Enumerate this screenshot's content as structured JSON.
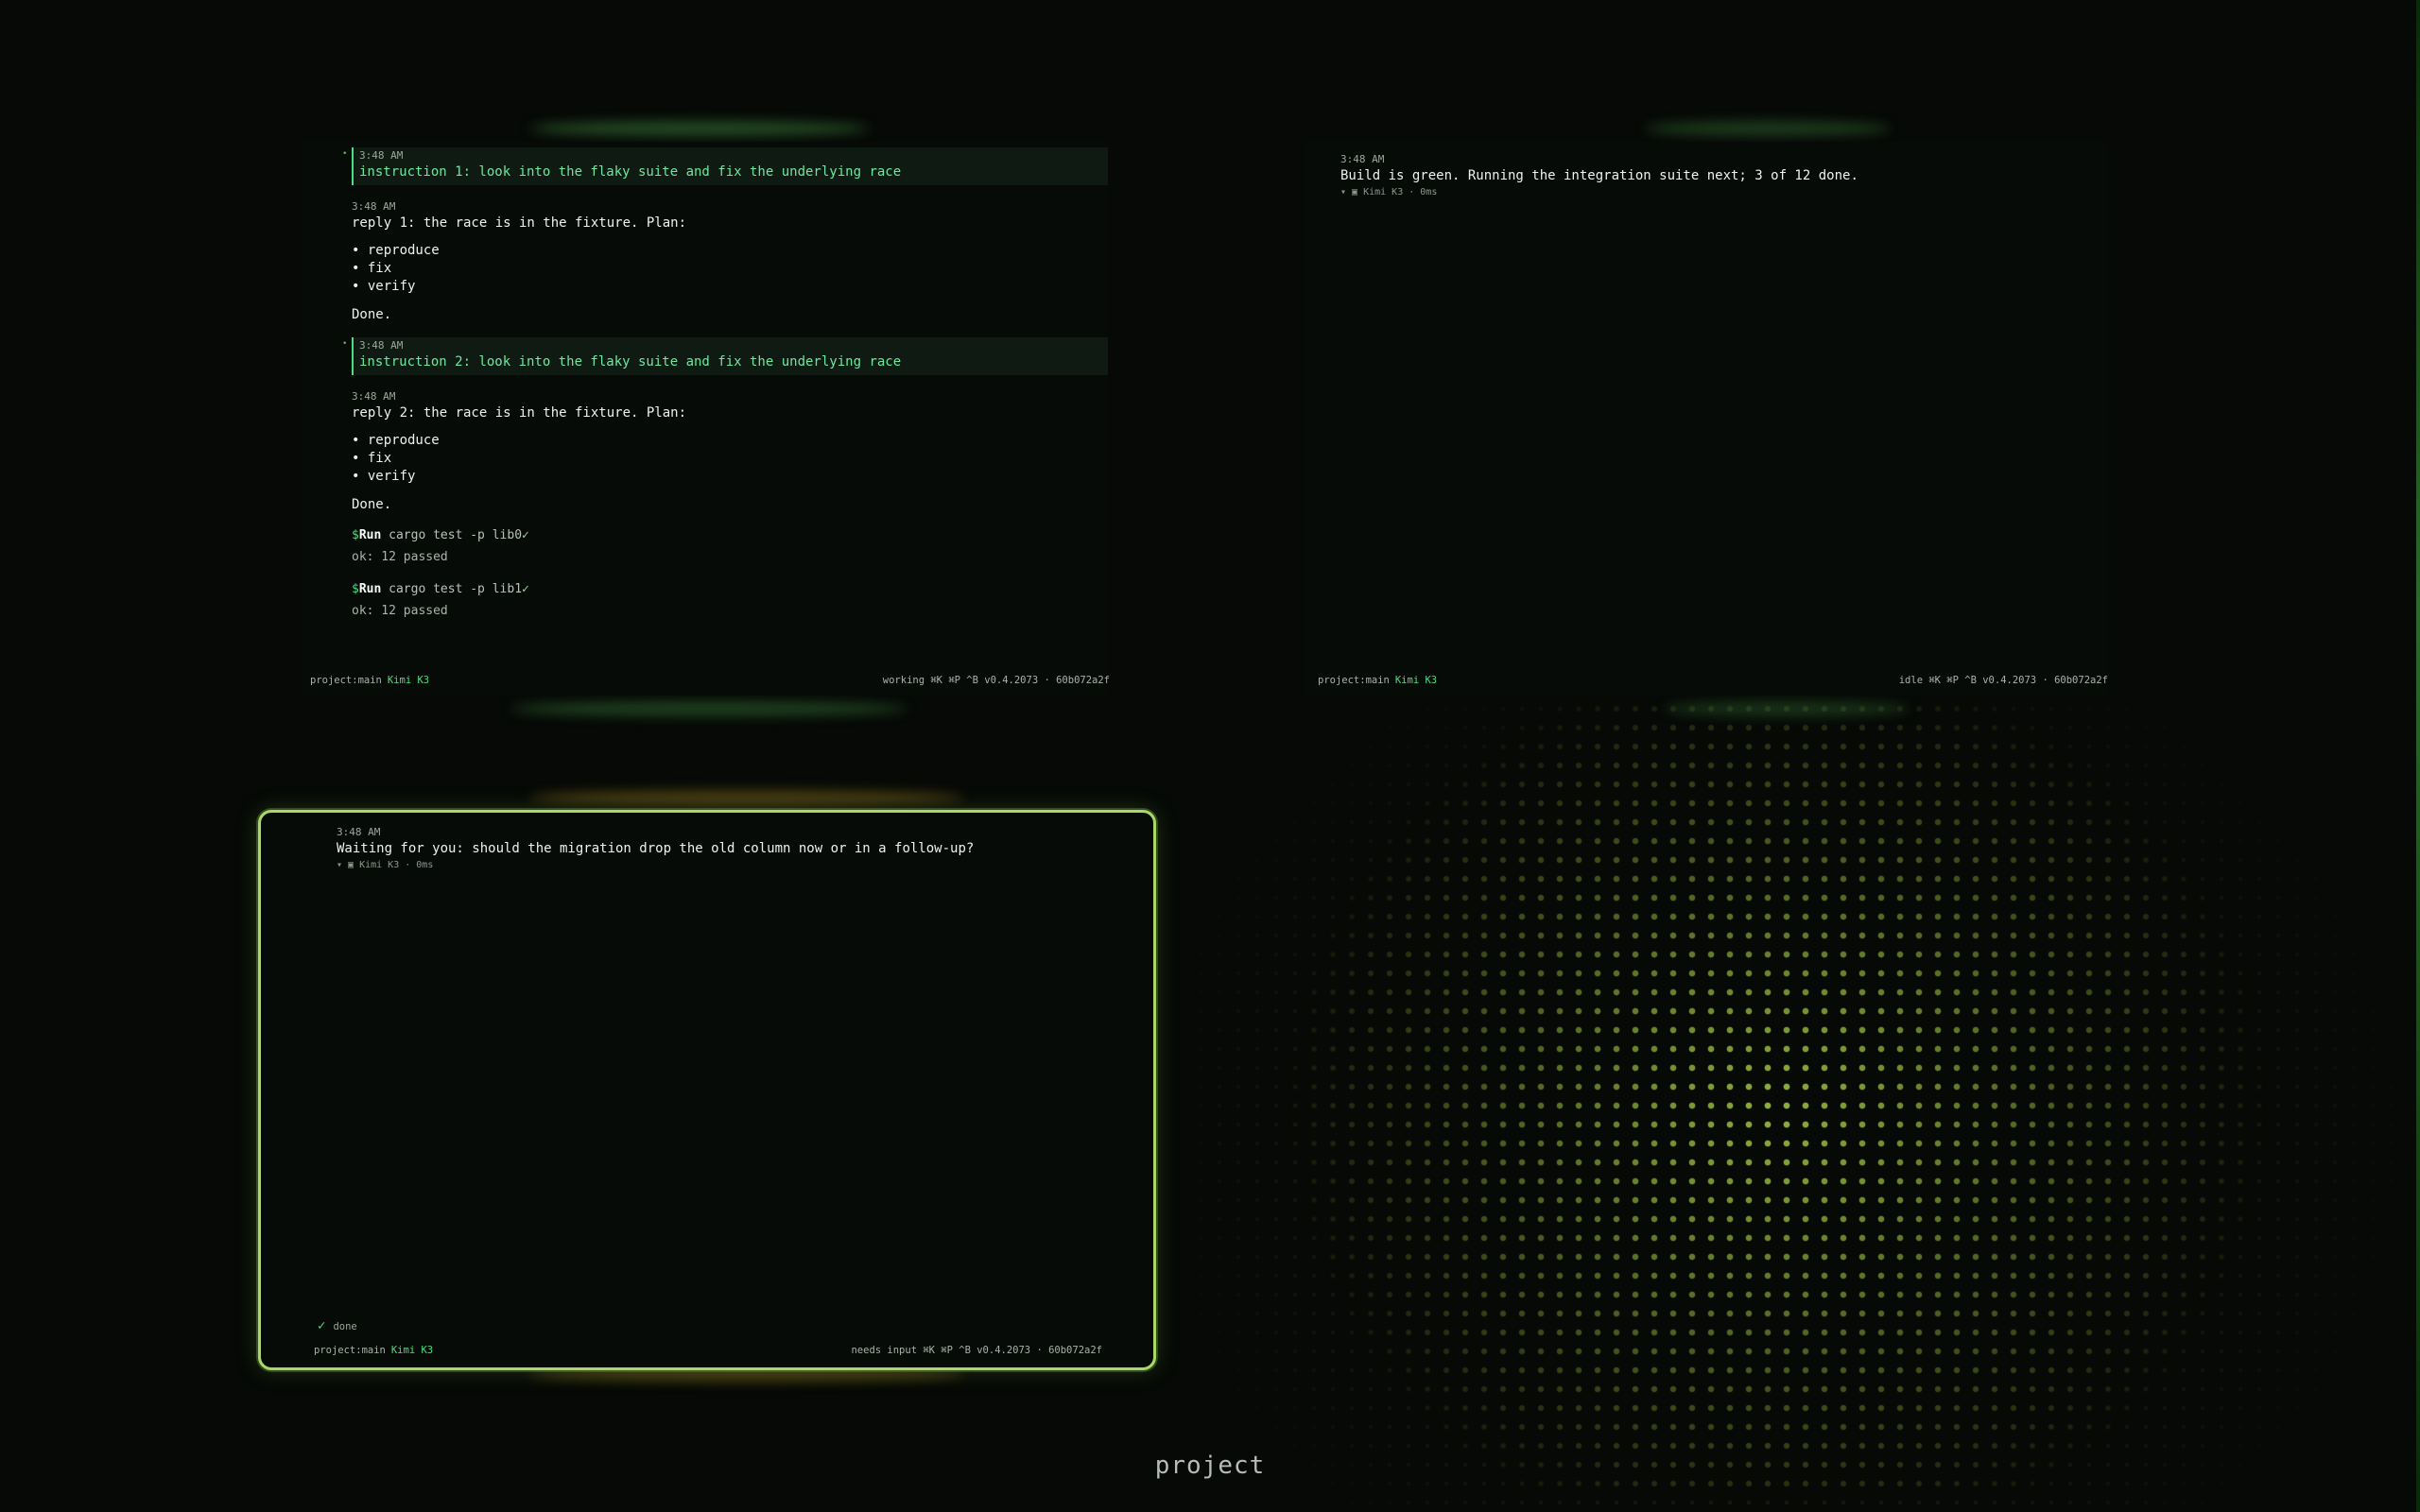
{
  "workspace_title": "project",
  "panes": [
    {
      "id": "pane-top-left",
      "status_left": "project:main",
      "model": "Kimi K3",
      "status_right": "working ⌘K ⌘P ^B v0.4.2073 · 60b072a2f",
      "entries": [
        {
          "kind": "instruction",
          "time": "3:48 AM",
          "text": "instruction 1: look into the flaky suite and fix the underlying race"
        },
        {
          "kind": "reply",
          "time": "3:48 AM",
          "text": "reply 1: the race is in the fixture. Plan:",
          "bullets": [
            "• reproduce",
            "• fix",
            "• verify"
          ],
          "done": "Done."
        },
        {
          "kind": "instruction",
          "time": "3:48 AM",
          "text": "instruction 2: look into the flaky suite and fix the underlying race"
        },
        {
          "kind": "reply",
          "time": "3:48 AM",
          "text": "reply 2: the race is in the fixture. Plan:",
          "bullets": [
            "• reproduce",
            "• fix",
            "• verify"
          ],
          "done": "Done."
        },
        {
          "kind": "run",
          "label": "Run",
          "cmd": "cargo test -p lib0",
          "check": "✓",
          "output": "ok: 12 passed"
        },
        {
          "kind": "run",
          "label": "Run",
          "cmd": "cargo test -p lib1",
          "check": "✓",
          "output": "ok: 12 passed"
        }
      ]
    },
    {
      "id": "pane-top-right",
      "status_left": "project:main",
      "model": "Kimi K3",
      "status_right": "idle ⌘K ⌘P ^B v0.4.2073 · 60b072a2f",
      "entries": [
        {
          "kind": "message",
          "time": "3:48 AM",
          "text": "Build is green. Running the integration suite next; 3 of 12 done.",
          "meta": "▾ ▣ Kimi K3 · 0ms"
        }
      ]
    },
    {
      "id": "pane-bottom-left",
      "status_left": "project:main",
      "model": "Kimi K3",
      "status_right": "needs input ⌘K ⌘P ^B v0.4.2073 · 60b072a2f",
      "done_label": "done",
      "entries": [
        {
          "kind": "message",
          "time": "3:48 AM",
          "text": "Waiting for you: should the migration drop the old column now or in a follow-up?",
          "meta": "▾ ▣ Kimi K3 · 0ms"
        }
      ]
    }
  ]
}
